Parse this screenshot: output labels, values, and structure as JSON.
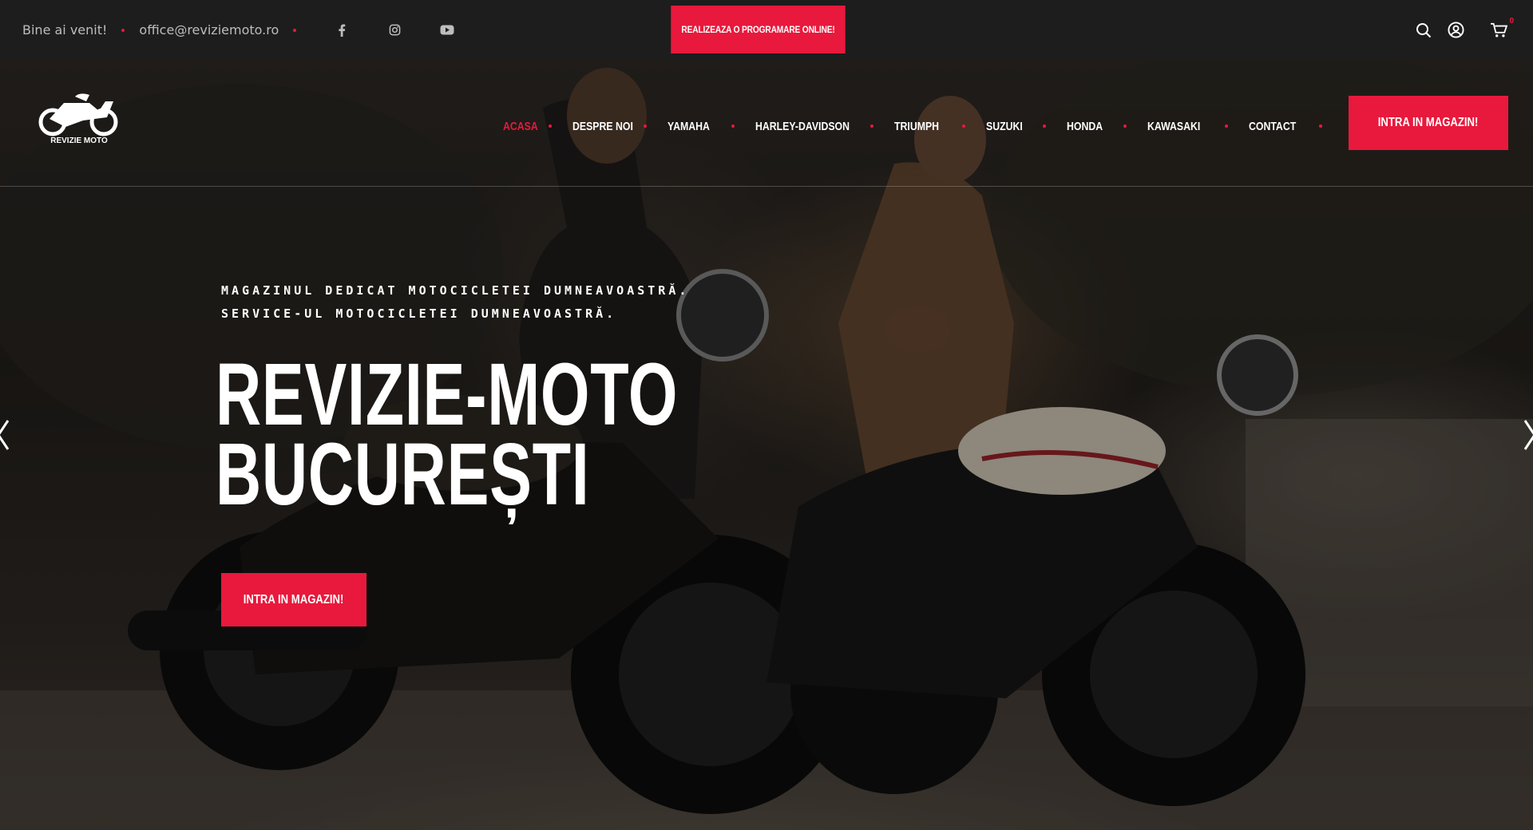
{
  "topbar": {
    "welcome": "Bine ai venit!",
    "email": "office@reviziemoto.ro",
    "social": [
      "facebook-icon",
      "instagram-icon",
      "youtube-icon"
    ],
    "appointment_button": "REALIZEAZA O PROGRAMARE ONLINE!",
    "cart_count": "0",
    "icons": [
      "search-icon",
      "user-icon",
      "cart-icon"
    ]
  },
  "header": {
    "logo_text": "REVIZIE MOTO",
    "nav": [
      "ACASA",
      "DESPRE NOI",
      "YAMAHA",
      "HARLEY-DAVIDSON",
      "TRIUMPH",
      "SUZUKI",
      "HONDA",
      "KAWASAKI",
      "CONTACT"
    ],
    "active_index": 0,
    "shop_button": "INTRA IN MAGAZIN!"
  },
  "hero": {
    "subtitle_line1": "MAGAZINUL DEDICAT MOTOCICLETEI DUMNEAVOASTRĂ.",
    "subtitle_line2": "SERVICE-UL MOTOCICLETEI DUMNEAVOASTRĂ.",
    "title_line1": "REVIZIE-MOTO",
    "title_line2": "BUCUREȘTI",
    "button": "INTRA IN MAGAZIN!"
  },
  "colors": {
    "accent": "#e8193c",
    "topbar_bg": "#1d1d1d",
    "text_muted": "#bdbdbd"
  }
}
